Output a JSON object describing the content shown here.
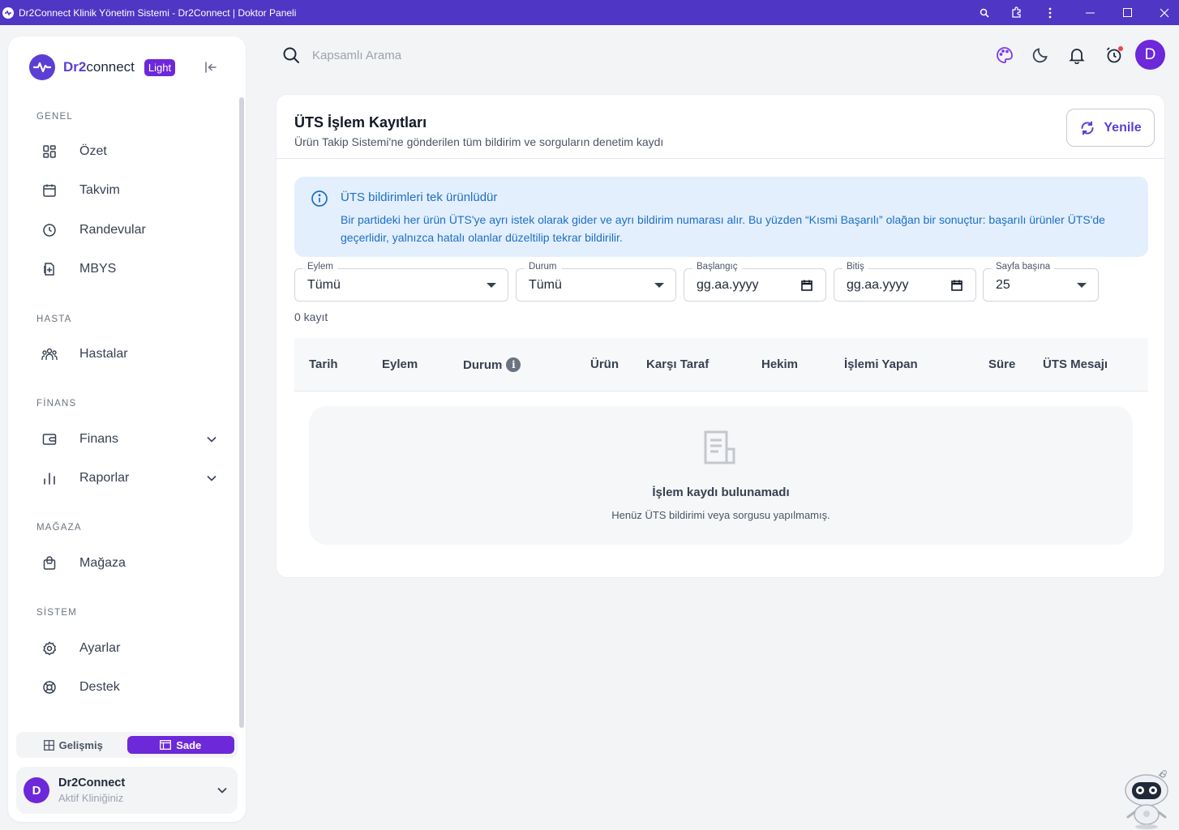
{
  "window": {
    "title": "Dr2Connect Klinik Yönetim Sistemi - Dr2Connect | Doktor Paneli",
    "controls": {
      "zoom": "🔍",
      "extensions": "⧉",
      "menu": "⋮",
      "minimize": "—",
      "maximize": "☐",
      "close": "✕"
    }
  },
  "brand": {
    "name_bold": "Dr2",
    "name_rest": "connect",
    "badge": "Light"
  },
  "sidebar": {
    "sections": [
      {
        "title": "GENEL",
        "items": [
          {
            "label": "Özet",
            "icon": "dashboard-icon"
          },
          {
            "label": "Takvim",
            "icon": "calendar-icon"
          },
          {
            "label": "Randevular",
            "icon": "clock-icon"
          },
          {
            "label": "MBYS",
            "icon": "file-plus-icon"
          }
        ]
      },
      {
        "title": "HASTA",
        "items": [
          {
            "label": "Hastalar",
            "icon": "users-icon"
          }
        ]
      },
      {
        "title": "FİNANS",
        "items": [
          {
            "label": "Finans",
            "icon": "wallet-icon",
            "expandable": true
          },
          {
            "label": "Raporlar",
            "icon": "bar-chart-icon",
            "expandable": true
          }
        ]
      },
      {
        "title": "MAĞAZA",
        "items": [
          {
            "label": "Mağaza",
            "icon": "shopping-bag-icon"
          }
        ]
      },
      {
        "title": "SİSTEM",
        "items": [
          {
            "label": "Ayarlar",
            "icon": "settings-icon"
          },
          {
            "label": "Destek",
            "icon": "lifebuoy-icon"
          }
        ]
      }
    ],
    "mode": {
      "advanced": "Gelişmiş",
      "simple": "Sade",
      "active": "simple"
    },
    "clinic": {
      "initial": "D",
      "name": "Dr2Connect",
      "subtitle": "Aktif Kliniğiniz"
    }
  },
  "topbar": {
    "search_placeholder": "Kapsamlı Arama",
    "avatar_initial": "D"
  },
  "page": {
    "title": "ÜTS İşlem Kayıtları",
    "subtitle": "Ürün Takip Sistemi'ne gönderilen tüm bildirim ve sorguların denetim kaydı",
    "refresh_label": "Yenile",
    "info": {
      "title": "ÜTS bildirimleri tek ürünlüdür",
      "body": "Bir partideki her ürün ÜTS'ye ayrı istek olarak gider ve ayrı bildirim numarası alır. Bu yüzden “Kısmi Başarılı” olağan bir sonuçtur: başarılı ürünler ÜTS'de geçerlidir, yalnızca hatalı olanlar düzeltilip tekrar bildirilir."
    },
    "filters": {
      "action": {
        "label": "Eylem",
        "value": "Tümü"
      },
      "status": {
        "label": "Durum",
        "value": "Tümü"
      },
      "start": {
        "label": "Başlangıç",
        "value": "gg.aa.yyyy"
      },
      "end": {
        "label": "Bitiş",
        "value": "gg.aa.yyyy"
      },
      "per_page": {
        "label": "Sayfa başına",
        "value": "25"
      }
    },
    "record_count": "0 kayıt",
    "columns": [
      "Tarih",
      "Eylem",
      "Durum",
      "Ürün",
      "Karşı Taraf",
      "Hekim",
      "İşlemi Yapan",
      "Süre",
      "ÜTS Mesajı"
    ],
    "empty": {
      "title": "İşlem kaydı bulunamadı",
      "subtitle": "Henüz ÜTS bildirimi veya sorgusu yapılmamış."
    }
  },
  "colors": {
    "accent": "#6d28d9",
    "brand": "#5b3fd4",
    "titlebar": "#4f36c4",
    "info_text": "#1e6fc4",
    "info_bg": "#e3effd"
  }
}
